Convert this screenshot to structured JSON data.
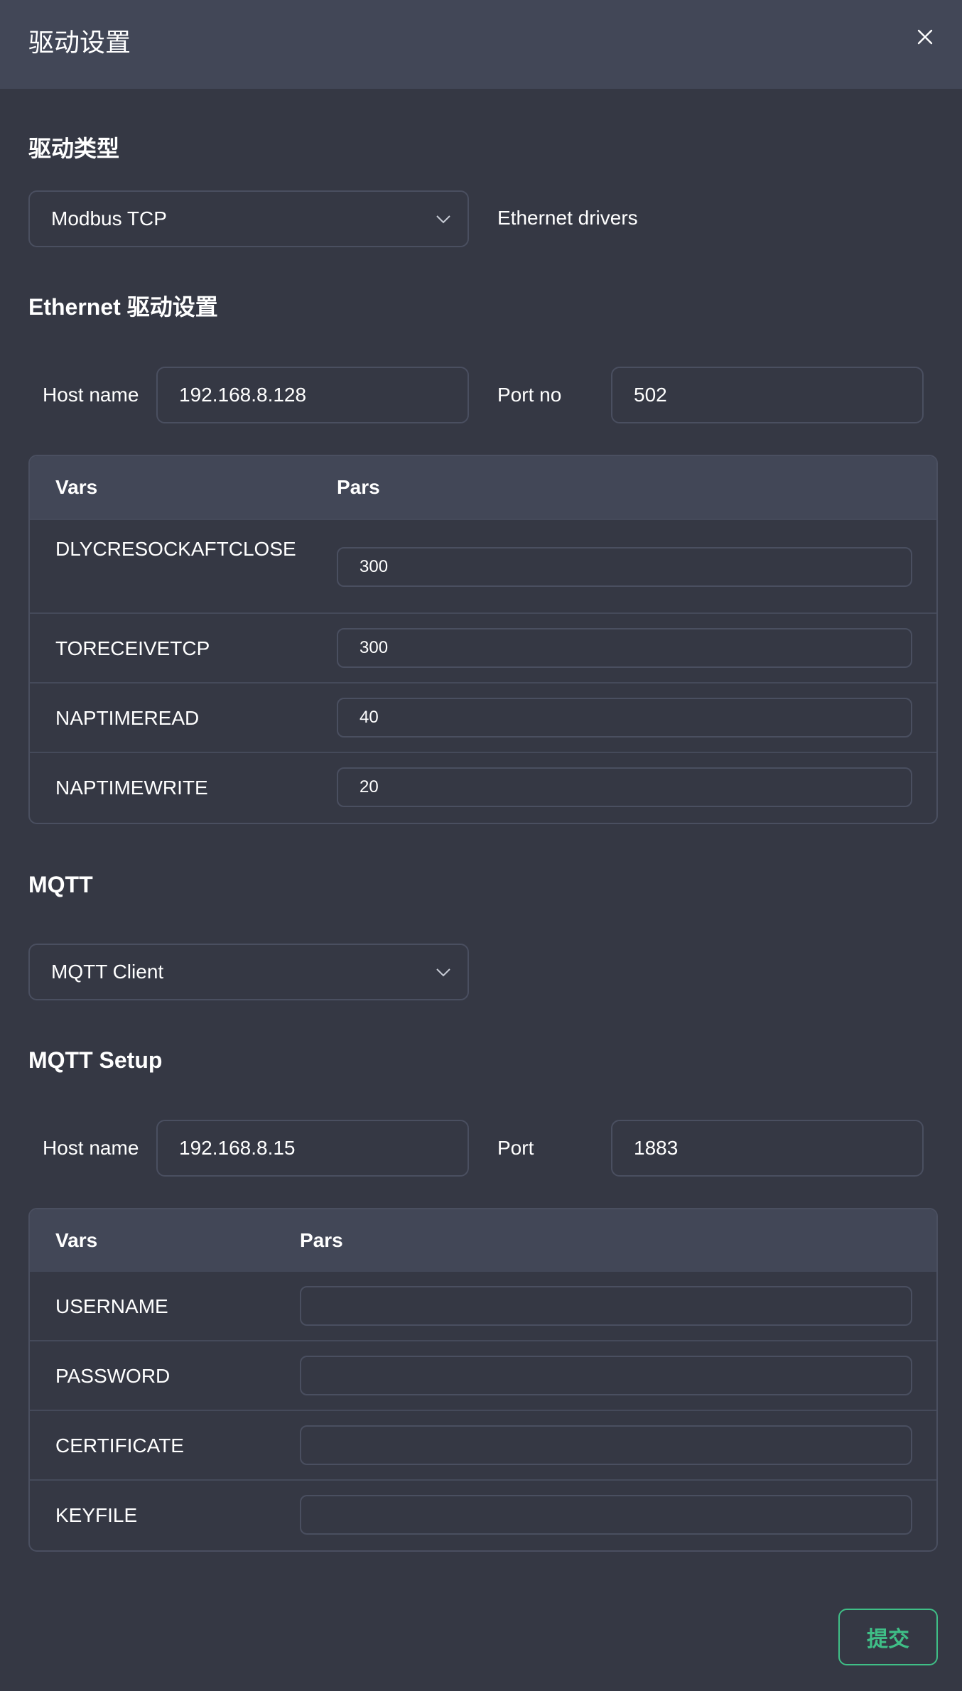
{
  "dialog": {
    "title": "驱动设置",
    "submit_label": "提交"
  },
  "driver": {
    "section_title": "驱动类型",
    "selected": "Modbus TCP",
    "hint": "Ethernet drivers"
  },
  "ethernet": {
    "section_title": "Ethernet 驱动设置",
    "host_label": "Host name",
    "host_value": "192.168.8.128",
    "port_label": "Port no",
    "port_value": "502",
    "table": {
      "col_vars": "Vars",
      "col_pars": "Pars",
      "rows": [
        {
          "name": "DLYCRESOCKAFTCLOSE",
          "value": "300"
        },
        {
          "name": "TORECEIVETCP",
          "value": "300"
        },
        {
          "name": "NAPTIMEREAD",
          "value": "40"
        },
        {
          "name": "NAPTIMEWRITE",
          "value": "20"
        }
      ]
    }
  },
  "mqtt": {
    "section_title": "MQTT",
    "selected": "MQTT Client",
    "setup_title": "MQTT Setup",
    "host_label": "Host name",
    "host_value": "192.168.8.15",
    "port_label": "Port",
    "port_value": "1883",
    "table": {
      "col_vars": "Vars",
      "col_pars": "Pars",
      "rows": [
        {
          "name": "USERNAME",
          "value": ""
        },
        {
          "name": "PASSWORD",
          "value": ""
        },
        {
          "name": "CERTIFICATE",
          "value": ""
        },
        {
          "name": "KEYFILE",
          "value": ""
        }
      ]
    }
  },
  "colors": {
    "background": "#353844",
    "header": "#424757",
    "border": "#4a4f60",
    "accent": "#3fbf87"
  }
}
